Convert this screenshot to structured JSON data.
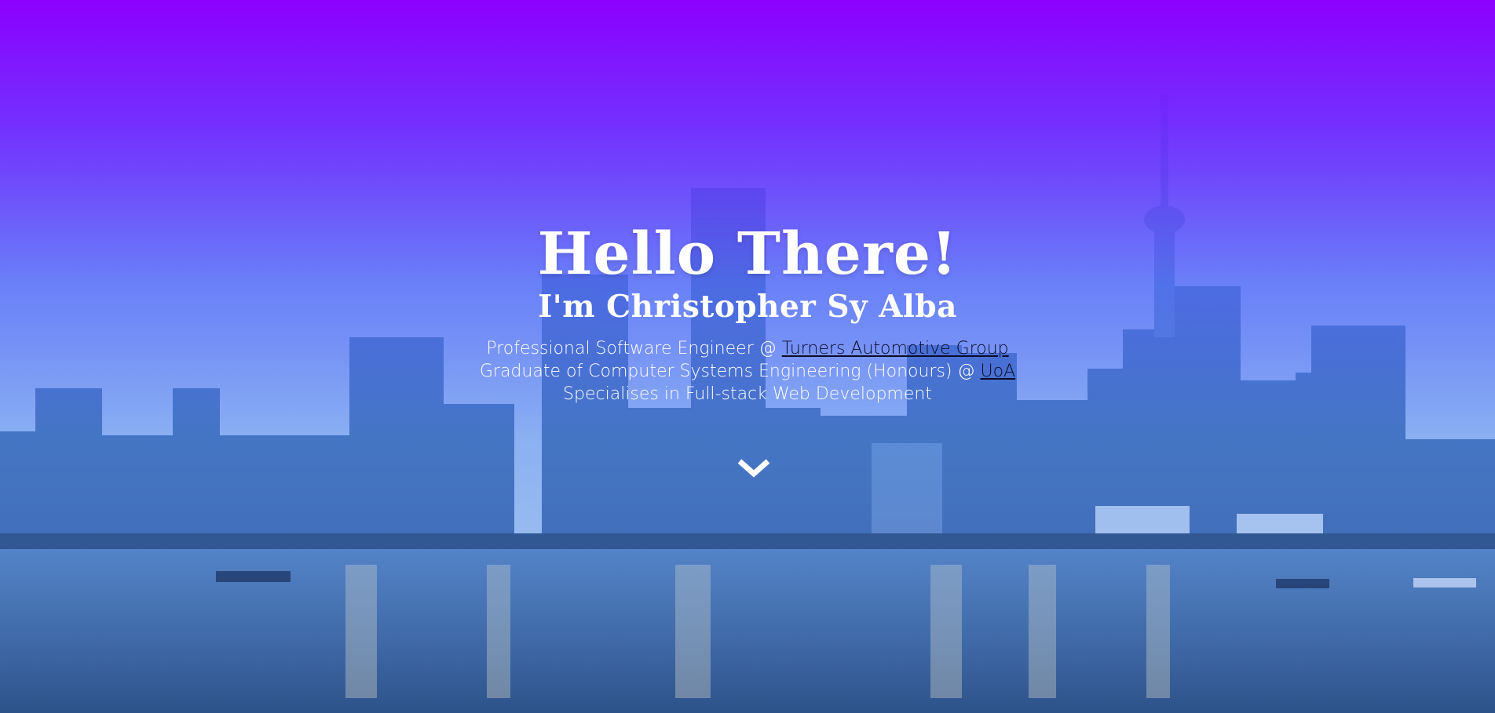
{
  "hero": {
    "title": "Hello There!",
    "subtitle": "I'm Christopher Sy Alba",
    "line1_prefix": "Professional Software Engineer @ ",
    "line1_link": "Turners Automotive Group",
    "line2_prefix": "Graduate of Computer Systems Engineering (Honours) @ ",
    "line2_link": "UoA",
    "line3": "Specialises in Full-stack Web Development",
    "scroll_icon": "chevron-down-icon"
  },
  "colors": {
    "overlay_top": "#8c00ff",
    "overlay_mid": "#5a78f5",
    "text": "#ffffff",
    "link": "#0b0b2a"
  }
}
